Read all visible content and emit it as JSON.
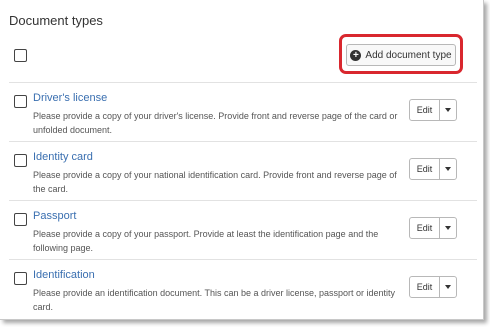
{
  "section": {
    "title": "Document types"
  },
  "toolbar": {
    "add_label": "Add document type"
  },
  "document_types": [
    {
      "name": "Driver's license",
      "description": "Please provide a copy of your driver's license. Provide front and reverse page of the card or unfolded document.",
      "edit_label": "Edit"
    },
    {
      "name": "Identity card",
      "description": "Please provide a copy of your national identification card. Provide front and reverse page of the card.",
      "edit_label": "Edit"
    },
    {
      "name": "Passport",
      "description": "Please provide a copy of your passport. Provide at least the identification page and the following page.",
      "edit_label": "Edit"
    },
    {
      "name": "Identification",
      "description": "Please provide an identification document. This can be a driver license, passport or identity card.",
      "edit_label": "Edit"
    }
  ],
  "colors": {
    "highlight": "#d9272e",
    "link": "#3a6fb0"
  },
  "icons": {
    "add": "plus-circle-icon",
    "dropdown": "caret-down-icon"
  }
}
